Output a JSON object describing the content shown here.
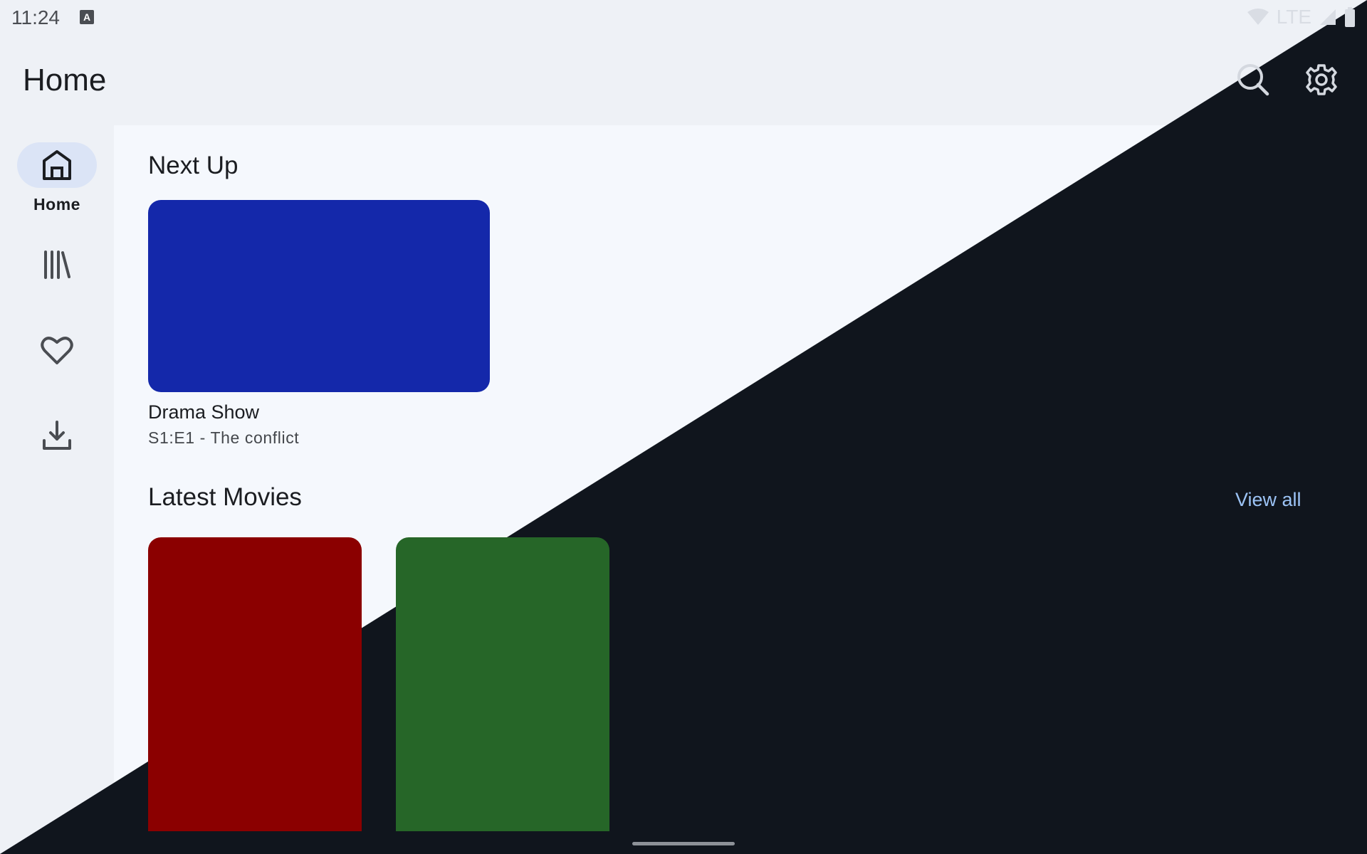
{
  "status_bar": {
    "time": "11:24",
    "network": "LTE",
    "keyboard_badge": "A"
  },
  "app_bar": {
    "title": "Home",
    "search_icon": "search-icon",
    "settings_icon": "gear-icon"
  },
  "nav_rail": {
    "items": [
      {
        "label": "Home",
        "icon": "home-icon",
        "selected": true
      },
      {
        "label": "",
        "icon": "library-icon",
        "selected": false
      },
      {
        "label": "",
        "icon": "heart-icon",
        "selected": false
      },
      {
        "label": "",
        "icon": "download-icon",
        "selected": false
      }
    ]
  },
  "next_up": {
    "title": "Next Up",
    "items": [
      {
        "title": "Drama Show",
        "subtitle": "S1:E1 - The conflict",
        "color": "#1428aa"
      }
    ]
  },
  "latest_movies": {
    "title": "Latest Movies",
    "view_all": "View all",
    "items": [
      {
        "color": "#8b0000"
      },
      {
        "color": "#266628"
      }
    ]
  },
  "colors": {
    "accent": "#9cc3f5",
    "rail_active": "#dbe4f6",
    "dark_bg": "#10151d"
  }
}
